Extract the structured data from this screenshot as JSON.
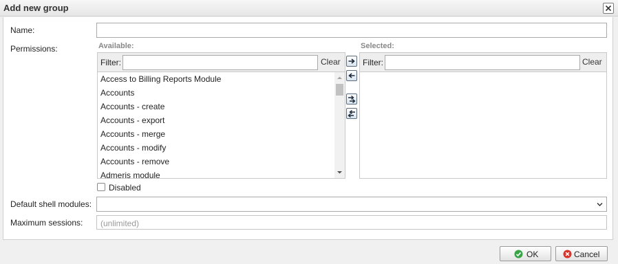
{
  "dialog": {
    "title": "Add new group"
  },
  "form": {
    "name_label": "Name:",
    "name_value": "",
    "permissions_label": "Permissions:",
    "default_shell_label": "Default shell modules:",
    "default_shell_value": "",
    "max_sessions_label": "Maximum sessions:",
    "max_sessions_placeholder": "(unlimited)",
    "disabled_label": "Disabled",
    "disabled_checked": false
  },
  "available": {
    "header": "Available:",
    "filter_label": "Filter:",
    "filter_value": "",
    "clear_label": "Clear",
    "items": [
      "Access to Billing Reports Module",
      "Accounts",
      "Accounts - create",
      "Accounts - export",
      "Accounts - merge",
      "Accounts - modify",
      "Accounts - remove",
      "Admeris module"
    ]
  },
  "selected": {
    "header": "Selected:",
    "filter_label": "Filter:",
    "filter_value": "",
    "clear_label": "Clear",
    "items": []
  },
  "move_buttons": [
    "move-right-icon",
    "move-left-icon",
    "move-all-right-icon",
    "move-all-left-icon"
  ],
  "footer": {
    "ok_label": "OK",
    "cancel_label": "Cancel"
  },
  "colors": {
    "ok_icon": "#3aa548",
    "cancel_icon": "#d9352b",
    "titlebar": "#e9e9e9",
    "section_header": "#888888"
  }
}
